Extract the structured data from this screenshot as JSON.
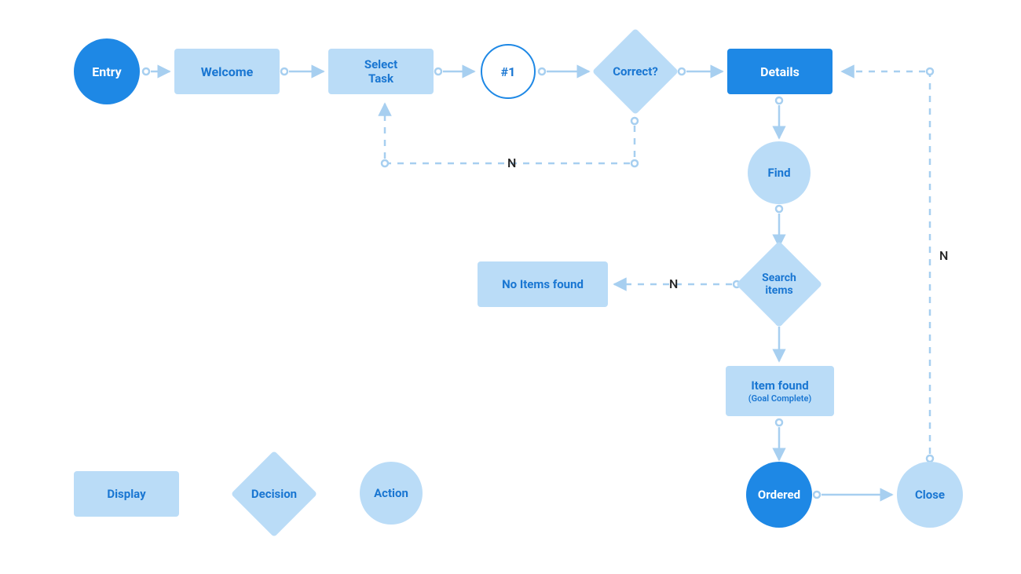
{
  "nodes": {
    "entry": "Entry",
    "welcome": "Welcome",
    "selectTask": "Select\nTask",
    "ref1": "#1",
    "correct": "Correct?",
    "details": "Details",
    "find": "Find",
    "searchItems": "Search\nitems",
    "noItems": "No Items found",
    "itemFound": "Item found",
    "itemFoundSub": "(Goal Complete)",
    "ordered": "Ordered",
    "close": "Close"
  },
  "legend": {
    "display": "Display",
    "decision": "Decision",
    "action": "Action"
  },
  "edgeLabels": {
    "n": "N"
  },
  "colors": {
    "light": "#BADCF7",
    "primary": "#1E88E5",
    "text": "#1976D2"
  }
}
